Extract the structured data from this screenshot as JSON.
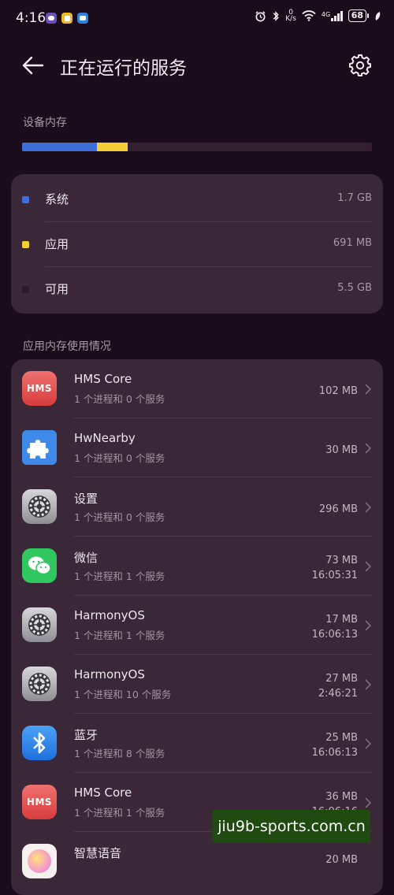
{
  "status_bar": {
    "time": "4:16",
    "net_speed_value": "0",
    "net_speed_unit": "K/s",
    "signal_label": "4G",
    "battery": "68"
  },
  "header": {
    "title": "正在运行的服务"
  },
  "memory": {
    "section_label": "设备内存",
    "bar": {
      "system_fraction": 0.214,
      "apps_fraction": 0.087
    },
    "legend": [
      {
        "label": "系统",
        "value": "1.7 GB",
        "color": "#3e6fd8"
      },
      {
        "label": "应用",
        "value": "691 MB",
        "color": "#f5cd35"
      },
      {
        "label": "可用",
        "value": "5.5 GB",
        "color": "#2d1a2a"
      }
    ]
  },
  "apps_section": {
    "label": "应用内存使用情况",
    "items": [
      {
        "name": "HMS Core",
        "sub": "1 个进程和 0 个服务",
        "size": "102 MB",
        "time": "",
        "icon": "hms-icon"
      },
      {
        "name": "HwNearby",
        "sub": "1 个进程和 0 个服务",
        "size": "30 MB",
        "time": "",
        "icon": "puzzle-icon"
      },
      {
        "name": "设置",
        "sub": "1 个进程和 0 个服务",
        "size": "296 MB",
        "time": "",
        "icon": "settings-gear-icon"
      },
      {
        "name": "微信",
        "sub": "1 个进程和 1 个服务",
        "size": "73 MB",
        "time": "16:05:31",
        "icon": "wechat-icon"
      },
      {
        "name": "HarmonyOS",
        "sub": "1 个进程和 1 个服务",
        "size": "17 MB",
        "time": "16:06:13",
        "icon": "settings-gear-icon"
      },
      {
        "name": "HarmonyOS",
        "sub": "1 个进程和 10 个服务",
        "size": "27 MB",
        "time": "2:46:21",
        "icon": "settings-gear-icon"
      },
      {
        "name": "蓝牙",
        "sub": "1 个进程和 8 个服务",
        "size": "25 MB",
        "time": "16:06:13",
        "icon": "bluetooth-icon"
      },
      {
        "name": "HMS Core",
        "sub": "1 个进程和 1 个服务",
        "size": "36 MB",
        "time": "16:06:16",
        "icon": "hms-icon"
      },
      {
        "name": "智慧语音",
        "sub": "",
        "size": "20 MB",
        "time": "",
        "icon": "voice-assistant-icon"
      }
    ]
  },
  "watermark": "jiu9b-sports.com.cn"
}
